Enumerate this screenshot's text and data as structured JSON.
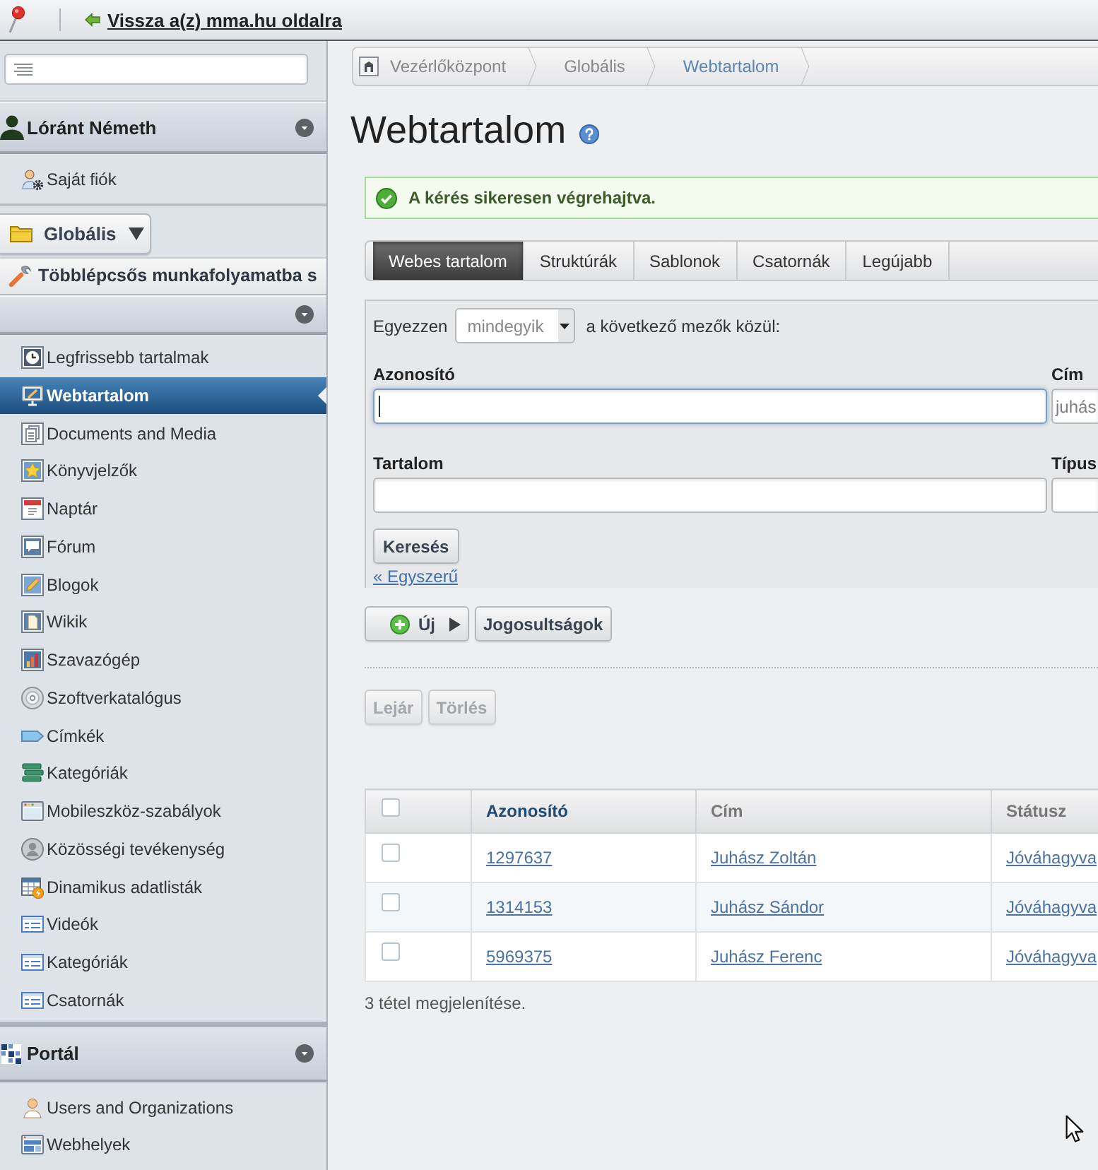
{
  "top_bar": {
    "back_link": "Vissza a(z) mma.hu oldalra"
  },
  "sidebar": {
    "user_panel": {
      "title": "Lóránt Németh",
      "items": [
        {
          "label": "Saját fiók",
          "kind": "account",
          "selected": false
        }
      ]
    },
    "site_selector": {
      "label": "Globális"
    },
    "workflow_bar": {
      "label": "Többlépcsős munkafolyamatba s"
    },
    "content_panel": {
      "items": [
        {
          "label": "Legfrissebb tartalmak",
          "kind": "clock",
          "selected": false
        },
        {
          "label": "Webtartalom",
          "kind": "monitor",
          "selected": true
        },
        {
          "label": "Documents and Media",
          "kind": "documents",
          "selected": false
        },
        {
          "label": "Könyvjelzők",
          "kind": "star",
          "selected": false
        },
        {
          "label": "Naptár",
          "kind": "calendar",
          "selected": false
        },
        {
          "label": "Fórum",
          "kind": "speech",
          "selected": false
        },
        {
          "label": "Blogok",
          "kind": "pencil",
          "selected": false
        },
        {
          "label": "Wikik",
          "kind": "page",
          "selected": false
        },
        {
          "label": "Szavazógép",
          "kind": "chart",
          "selected": false
        },
        {
          "label": "Szoftverkatalógus",
          "kind": "disc",
          "selected": false
        },
        {
          "label": "Címkék",
          "kind": "tag",
          "selected": false
        },
        {
          "label": "Kategóriák",
          "kind": "layers",
          "selected": false
        },
        {
          "label": "Mobileszköz-szabályok",
          "kind": "window",
          "selected": false
        },
        {
          "label": "Közösségi tevékenység",
          "kind": "avatar",
          "selected": false
        },
        {
          "label": "Dinamikus adatlisták",
          "kind": "table",
          "selected": false
        },
        {
          "label": "Videók",
          "kind": "list",
          "selected": false
        },
        {
          "label": "Kategóriák",
          "kind": "list",
          "selected": false
        },
        {
          "label": "Csatornák",
          "kind": "list",
          "selected": false
        }
      ]
    },
    "portal_panel": {
      "title": "Portál",
      "items": [
        {
          "label": "Users and Organizations",
          "kind": "person",
          "selected": false
        },
        {
          "label": "Webhelyek",
          "kind": "site",
          "selected": false
        }
      ]
    }
  },
  "breadcrumb": [
    {
      "label": "Vezérlőközpont",
      "current": false
    },
    {
      "label": "Globális",
      "current": false
    },
    {
      "label": "Webtartalom",
      "current": true
    }
  ],
  "page_title": "Webtartalom",
  "message": {
    "kind": "success",
    "text": "A kérés sikeresen végrehajtva."
  },
  "tabs": [
    {
      "label": "Webes tartalom",
      "selected": true
    },
    {
      "label": "Struktúrák",
      "selected": false
    },
    {
      "label": "Sablonok",
      "selected": false
    },
    {
      "label": "Csatornák",
      "selected": false
    },
    {
      "label": "Legújabb",
      "selected": false
    }
  ],
  "search_form": {
    "match_label": "Egyezzen",
    "match_select": "mindegyik",
    "match_suffix": "a következő mezők közül:",
    "fields": [
      {
        "label": "Azonosító",
        "focused": true
      },
      {
        "label": "Cím",
        "value": "juhás",
        "focused": false
      },
      {
        "label": "Tartalom",
        "focused": false
      },
      {
        "label": "Típus",
        "focused": false
      }
    ],
    "submit": "Keresés",
    "toggle_link": "« Egyszerű"
  },
  "actions": {
    "new_button": "Új",
    "permissions_button": "Jogosultságok"
  },
  "bulk_actions": [
    {
      "label": "Lejár",
      "disabled": true
    },
    {
      "label": "Törlés",
      "disabled": true
    }
  ],
  "table": {
    "select_all_checked": false,
    "columns": [
      {
        "label": "Azonosító",
        "sorted": true
      },
      {
        "label": "Cím",
        "sorted": false
      },
      {
        "label": "Státusz",
        "sorted": false
      }
    ],
    "rows": [
      {
        "checked": false,
        "id": "1297637",
        "title": "Juhász Zoltán",
        "status": "Jóváhagyva"
      },
      {
        "checked": false,
        "id": "1314153",
        "title": "Juhász Sándor",
        "status": "Jóváhagyva"
      },
      {
        "checked": false,
        "id": "5969375",
        "title": "Juhász Ferenc",
        "status": "Jóváhagyva"
      }
    ]
  },
  "result_count": "3 tétel megjelenítése."
}
